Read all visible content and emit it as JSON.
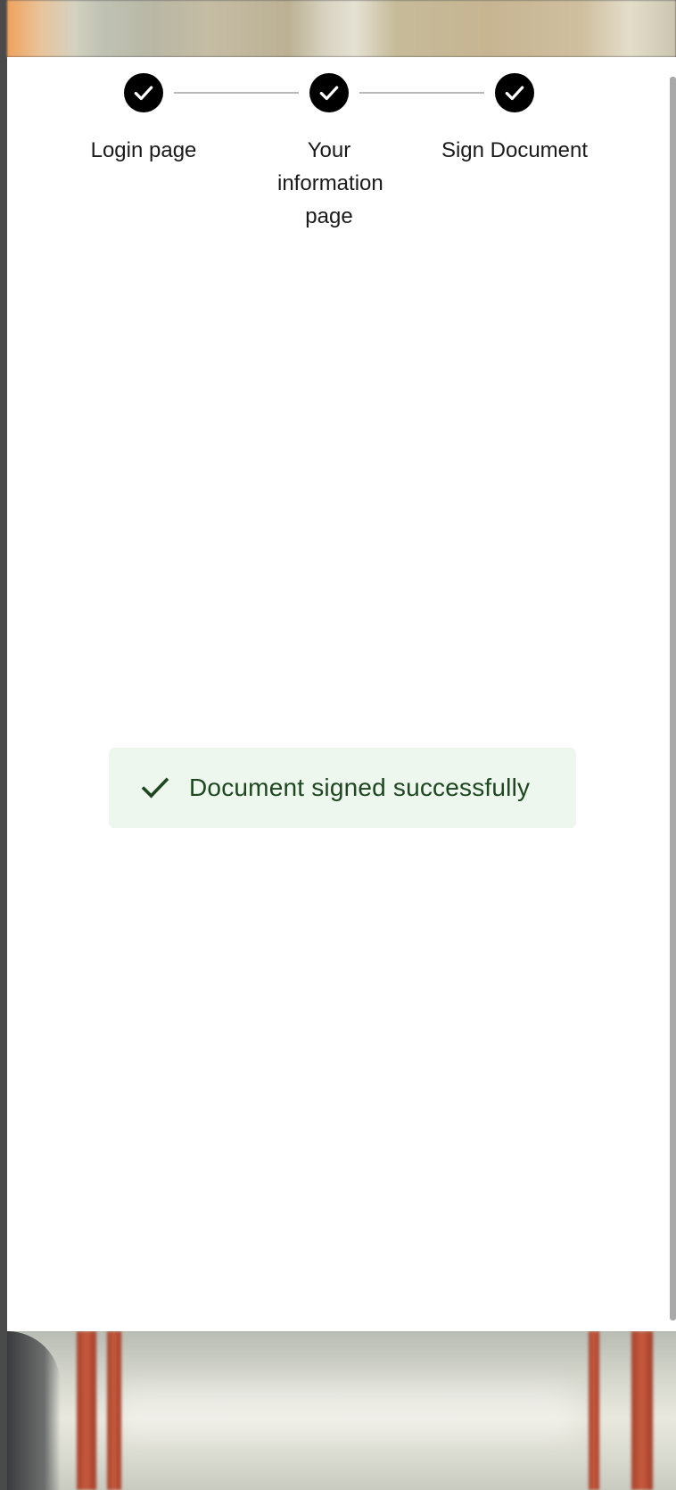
{
  "stepper": {
    "steps": [
      {
        "label": "Login page",
        "status": "completed",
        "icon": "check-icon"
      },
      {
        "label": "Your information page",
        "status": "completed",
        "icon": "check-icon"
      },
      {
        "label": "Sign Document",
        "status": "completed",
        "icon": "check-icon"
      }
    ],
    "active_color": "#000000",
    "connector_color": "#b8b8b8"
  },
  "alert": {
    "severity": "success",
    "icon": "check-icon",
    "message": "Document signed successfully",
    "background": "#edf7ed",
    "text_color": "#1e4620"
  }
}
